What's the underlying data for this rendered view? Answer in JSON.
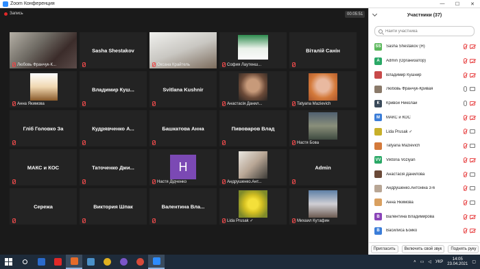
{
  "window": {
    "title": "Zoom Конференция"
  },
  "recording": {
    "label": "Запись"
  },
  "timer": {
    "value": "00:05:51"
  },
  "tiles": [
    {
      "label": "Любовь Франчук-К..."
    },
    {
      "name": "Sasha Shestakov"
    },
    {
      "label": "Оксана Крайтель"
    },
    {
      "label": "София Лаутенш..."
    },
    {
      "name": "Віталій Санін"
    },
    {
      "label": "Анна Якимова"
    },
    {
      "name": "Владимир  Куш..."
    },
    {
      "name": "Svitlana Kushnir"
    },
    {
      "label": "Анастасія Данил..."
    },
    {
      "label": "Tatyana Mazievich"
    },
    {
      "name": "Гліб Головко За"
    },
    {
      "name": "Кудрявченко   А..."
    },
    {
      "name": "Башкатова Анна"
    },
    {
      "name": "Пивоваров Влад"
    },
    {
      "label": "Настя Бова"
    },
    {
      "name": "МАКС и КОС"
    },
    {
      "name": "Таточенко  Дми..."
    },
    {
      "avatar_letter": "H",
      "label": "Настя Дідченко"
    },
    {
      "label": "Андрушенко.Ант..."
    },
    {
      "name": "Admin"
    },
    {
      "name": "Сережа"
    },
    {
      "name": "Виктория Шпак"
    },
    {
      "name": "Валентина  Вла..."
    },
    {
      "label": "Lida Prusak ✓"
    },
    {
      "label": "Михаил Кутафин"
    }
  ],
  "participants_panel": {
    "title": "Участники (37)",
    "search_placeholder": "Найти участника",
    "items": [
      {
        "initials": "SS",
        "color": "#5cb85c",
        "name": "Sasha Shestakov (Я)",
        "mic": "off",
        "cam": "off"
      },
      {
        "initials": "A",
        "color": "#2aa866",
        "name": "Admin (Организатор)",
        "mic": "off",
        "cam": "off"
      },
      {
        "initials": "",
        "color": "#c84a4a",
        "name": "Владимир Кушнир",
        "mic": "off",
        "cam": "off"
      },
      {
        "initials": "",
        "color": "#8a7a6a",
        "name": "Любовь Франчук-Кривая",
        "mic": "on",
        "cam": "on"
      },
      {
        "initials": "К",
        "color": "#3a4a5a",
        "name": "Кривой Николай",
        "mic": "on",
        "cam": "off"
      },
      {
        "initials": "М",
        "color": "#3b7dd8",
        "name": "МАКС и КОС",
        "mic": "off",
        "cam": "off"
      },
      {
        "initials": "",
        "color": "#c8b02a",
        "name": "Lida Prusak ✓",
        "mic": "off",
        "cam": "on"
      },
      {
        "initials": "",
        "color": "#d47a3b",
        "name": "Tatyana Mazievich",
        "mic": "off",
        "cam": "on"
      },
      {
        "initials": "VV",
        "color": "#2aa866",
        "name": "Viktoria Voziyan",
        "mic": "off",
        "cam": "off"
      },
      {
        "initials": "",
        "color": "#6b4a38",
        "name": "Анастасія Данилова",
        "mic": "off",
        "cam": "on"
      },
      {
        "initials": "",
        "color": "#b8a695",
        "name": "Андрушенко.Антоніна 3-6",
        "mic": "off",
        "cam": "on"
      },
      {
        "initials": "",
        "color": "#d9a060",
        "name": "Анна Якимова",
        "mic": "off",
        "cam": "on"
      },
      {
        "initials": "В",
        "color": "#8a44b8",
        "name": "Валентина Владимирова",
        "mic": "off",
        "cam": "off"
      },
      {
        "initials": "В",
        "color": "#3b7dd8",
        "name": "Василиса Бойко",
        "mic": "off",
        "cam": "off"
      }
    ],
    "footer": {
      "invite": "Пригласить",
      "unmute": "Включить свой звук",
      "raise_hand": "Поднять руку"
    }
  },
  "taskbar": {
    "lang": "УКР",
    "time": "14:05",
    "date": "23.04.2021"
  }
}
